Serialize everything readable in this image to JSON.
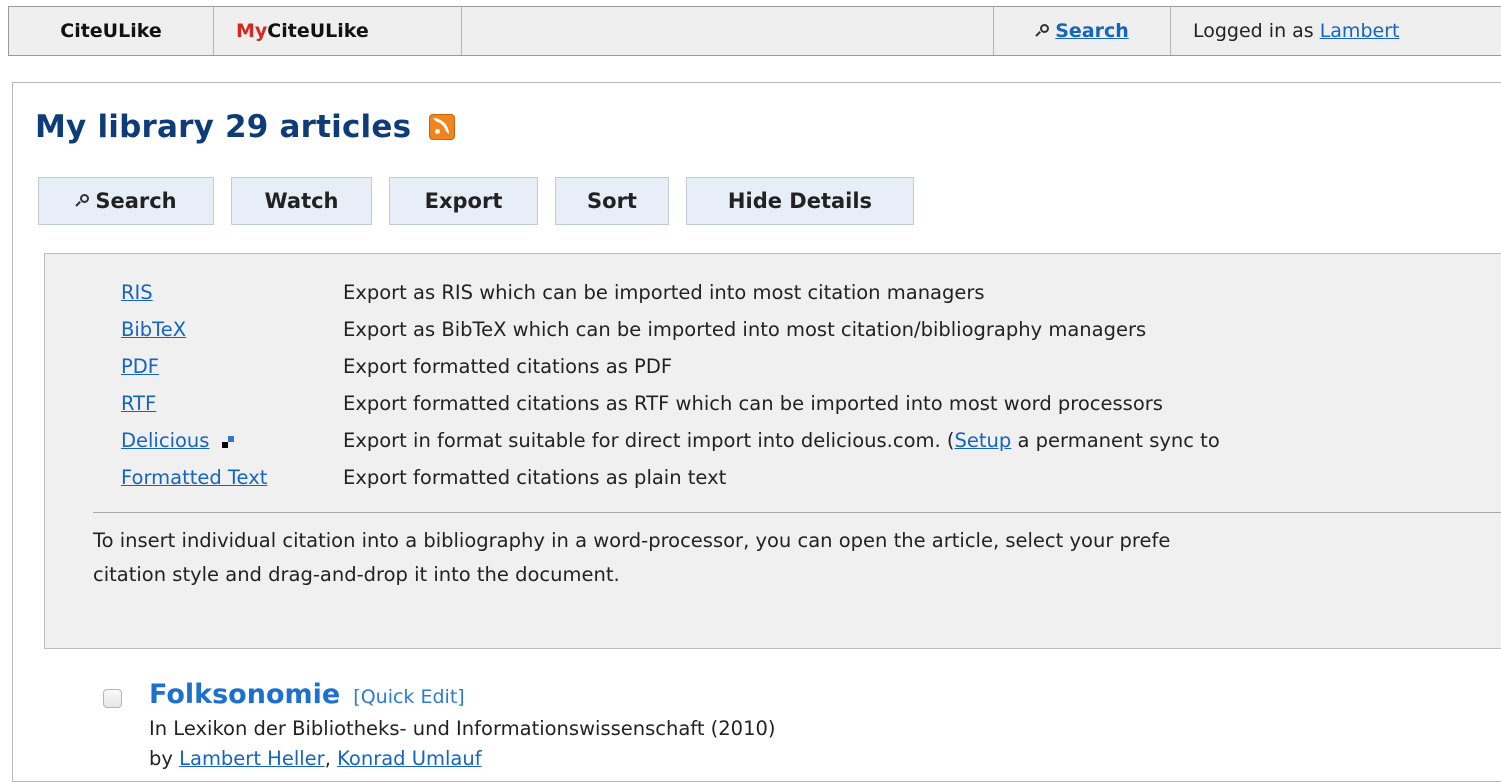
{
  "nav": {
    "brand": "CiteULike",
    "my_prefix": "My",
    "my_suffix": "CiteULike",
    "search_label": "Search",
    "logged_in_text": "Logged in as",
    "user": "Lambert"
  },
  "page": {
    "title": "My library 29 articles"
  },
  "toolbar": {
    "search": "Search",
    "watch": "Watch",
    "export": "Export",
    "sort": "Sort",
    "hide_details": "Hide Details"
  },
  "export": {
    "formats": [
      {
        "name": "RIS",
        "description": "Export as RIS which can be imported into most citation managers"
      },
      {
        "name": "BibTeX",
        "description": "Export as BibTeX which can be imported into most citation/bibliography managers"
      },
      {
        "name": "PDF",
        "description": "Export formatted citations as PDF"
      },
      {
        "name": "RTF",
        "description": "Export formatted citations as RTF which can be imported into most word processors"
      },
      {
        "name": "Delicious",
        "description_pre": "Export in format suitable for direct import into delicious.com. (",
        "setup_link": "Setup",
        "description_post": " a permanent sync to"
      },
      {
        "name": "Formatted Text",
        "description": "Export formatted citations as plain text"
      }
    ],
    "note_line1": "To insert individual citation into a bibliography in a word-processor, you can open the article, select your prefe",
    "note_line2": "citation style and drag-and-drop it into the document."
  },
  "articles": [
    {
      "title": "Folksonomie",
      "quick_edit": "[Quick Edit]",
      "source": "In Lexikon der Bibliotheks- und Informationswissenschaft (2010)",
      "by": "by",
      "authors": [
        "Lambert Heller",
        "Konrad Umlauf"
      ]
    }
  ],
  "icons": {
    "search": "magnifier-icon",
    "rss": "rss-feed-icon",
    "delicious": "delicious-icon"
  },
  "colors": {
    "title": "#0d3c78",
    "link": "#1565c0",
    "my_accent": "#d2281e",
    "button_bg": "#e8eef8",
    "rss": "#f0841f"
  }
}
